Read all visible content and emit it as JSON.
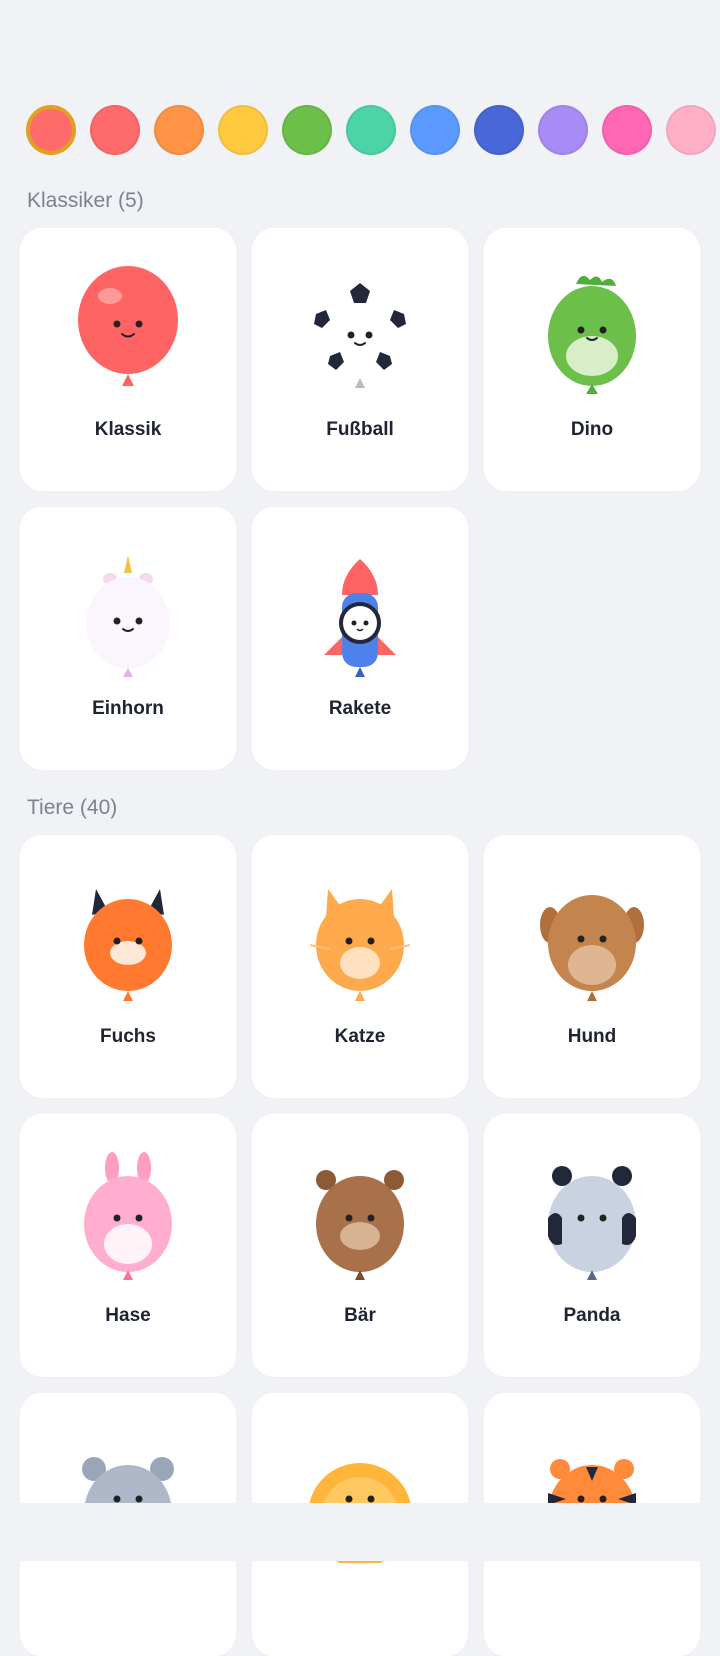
{
  "palette": {
    "selected_index": 0,
    "colors": [
      "#ff6b6b",
      "#ff6b6b",
      "#ff9447",
      "#ffc940",
      "#6cc04a",
      "#4dd4a6",
      "#5b9bff",
      "#4a67d8",
      "#a98bf5",
      "#ff66b3",
      "#ffb0c8"
    ]
  },
  "sections": [
    {
      "title": "Klassiker (5)",
      "items": [
        {
          "label": "Klassik",
          "icon": "classic-balloon-icon"
        },
        {
          "label": "Fußball",
          "icon": "soccer-balloon-icon"
        },
        {
          "label": "Dino",
          "icon": "dino-balloon-icon"
        },
        {
          "label": "Einhorn",
          "icon": "unicorn-balloon-icon"
        },
        {
          "label": "Rakete",
          "icon": "rocket-balloon-icon"
        }
      ]
    },
    {
      "title": "Tiere (40)",
      "items": [
        {
          "label": "Fuchs",
          "icon": "fox-balloon-icon"
        },
        {
          "label": "Katze",
          "icon": "cat-balloon-icon"
        },
        {
          "label": "Hund",
          "icon": "dog-balloon-icon"
        },
        {
          "label": "Hase",
          "icon": "bunny-balloon-icon"
        },
        {
          "label": "Bär",
          "icon": "bear-balloon-icon"
        },
        {
          "label": "Panda",
          "icon": "panda-balloon-icon"
        },
        {
          "label": "",
          "icon": "mouse-balloon-icon"
        },
        {
          "label": "",
          "icon": "lion-balloon-icon"
        },
        {
          "label": "",
          "icon": "tiger-balloon-icon"
        }
      ]
    }
  ]
}
